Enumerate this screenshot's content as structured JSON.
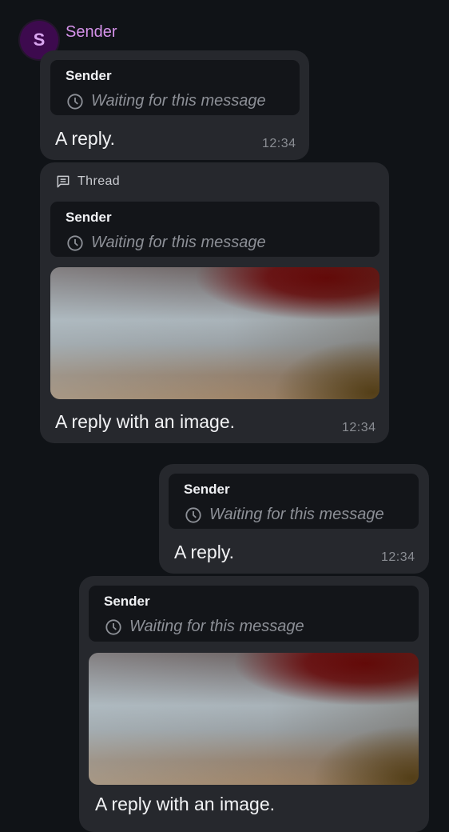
{
  "header": {
    "avatar_initial": "S",
    "sender_name": "Sender"
  },
  "messages": [
    {
      "reply_sender": "Sender",
      "reply_status": "Waiting for this message",
      "text": "A reply.",
      "time": "12:34"
    },
    {
      "thread_label": "Thread",
      "reply_sender": "Sender",
      "reply_status": "Waiting for this message",
      "text": "A reply with an image.",
      "time": "12:34"
    },
    {
      "reply_sender": "Sender",
      "reply_status": "Waiting for this message",
      "text": "A reply.",
      "time": "12:34"
    },
    {
      "reply_sender": "Sender",
      "reply_status": "Waiting for this message",
      "text": "A reply with an image."
    }
  ],
  "colors": {
    "background": "#101317",
    "bubble": "#26282d",
    "reply_box": "#131519",
    "sender_name": "#d592ea",
    "avatar_bg": "#3d0a4e"
  },
  "icons": {
    "pending": "clock-icon",
    "thread": "thread-icon"
  }
}
